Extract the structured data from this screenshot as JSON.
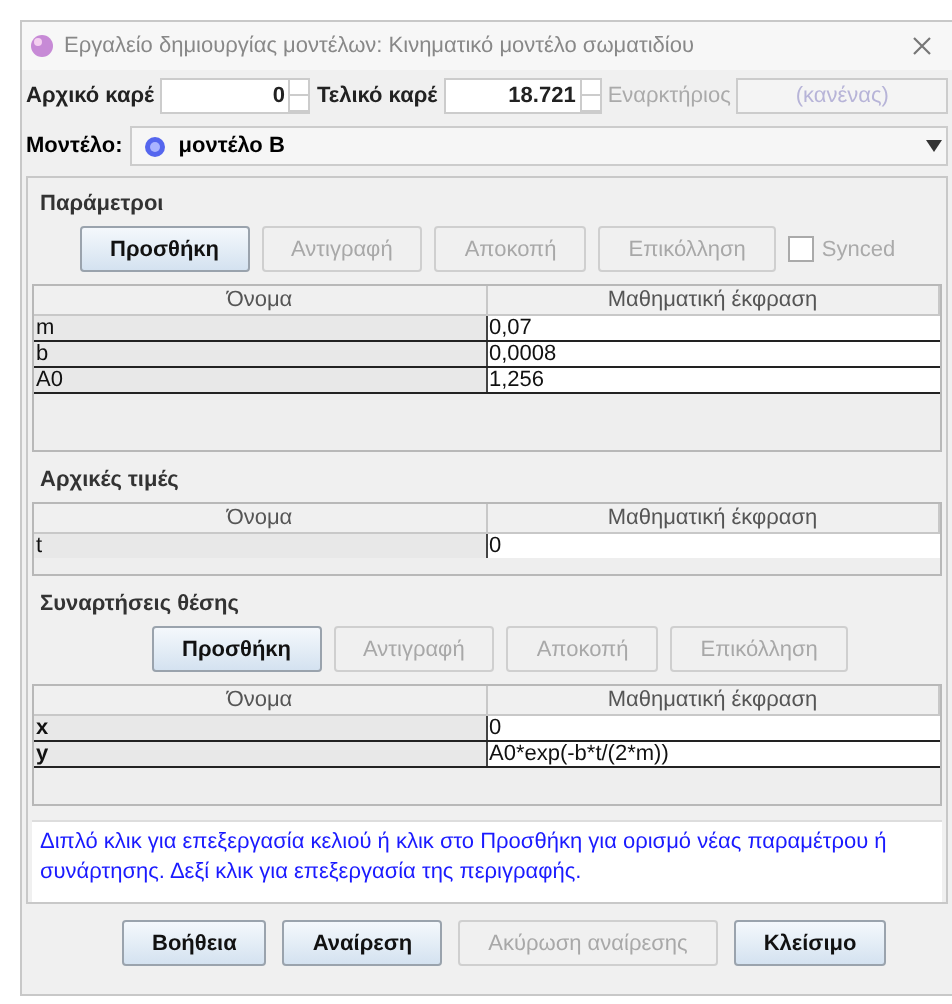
{
  "window": {
    "title": "Εργαλείο δημιουργίας μοντέλων: Κινηματικό μοντέλο σωματιδίου"
  },
  "frames": {
    "start_label": "Αρχικό καρέ",
    "start_value": "0",
    "end_label": "Τελικό καρέ",
    "end_value": "18.721",
    "trigger_label": "Εναρκτήριος",
    "trigger_value": "(κανένας)"
  },
  "model": {
    "label": "Μοντέλο:",
    "value": "μοντέλο B"
  },
  "sections": [
    {
      "title": "Παράμετροι",
      "buttons": [
        {
          "label": "Προσθήκη",
          "disabled": false
        },
        {
          "label": "Αντιγραφή",
          "disabled": true
        },
        {
          "label": "Αποκοπή",
          "disabled": true
        },
        {
          "label": "Επικόλληση",
          "disabled": true
        }
      ],
      "synced": {
        "label": "Synced",
        "checked": false
      },
      "columns": [
        "Όνομα",
        "Μαθηματική έκφραση"
      ],
      "rows": [
        {
          "name": "m",
          "expression": "0,07"
        },
        {
          "name": "b",
          "expression": "0,0008"
        },
        {
          "name": "A0",
          "expression": "1,256"
        }
      ]
    },
    {
      "title": "Αρχικές τιμές",
      "columns": [
        "Όνομα",
        "Μαθηματική έκφραση"
      ],
      "rows": [
        {
          "name": "t",
          "expression": "0"
        }
      ]
    },
    {
      "title": "Συναρτήσεις θέσης",
      "buttons": [
        {
          "label": "Προσθήκη",
          "disabled": false
        },
        {
          "label": "Αντιγραφή",
          "disabled": true
        },
        {
          "label": "Αποκοπή",
          "disabled": true
        },
        {
          "label": "Επικόλληση",
          "disabled": true
        }
      ],
      "columns": [
        "Όνομα",
        "Μαθηματική έκφραση"
      ],
      "rows": [
        {
          "name": "x",
          "expression": "0"
        },
        {
          "name": "y",
          "expression": "A0*exp(-b*t/(2*m))"
        }
      ]
    }
  ],
  "hint": "Διπλό κλικ για επεξεργασία κελιού ή κλικ στο Προσθήκη για ορισμό νέας παραμέτρου ή συνάρτησης.  Δεξί κλικ για επεξεργασία της περιγραφής.",
  "buttons": [
    {
      "label": "Βοήθεια",
      "disabled": false
    },
    {
      "label": "Αναίρεση",
      "disabled": false
    },
    {
      "label": "Ακύρωση αναίρεσης",
      "disabled": true
    },
    {
      "label": "Κλείσιμο",
      "disabled": false
    }
  ]
}
